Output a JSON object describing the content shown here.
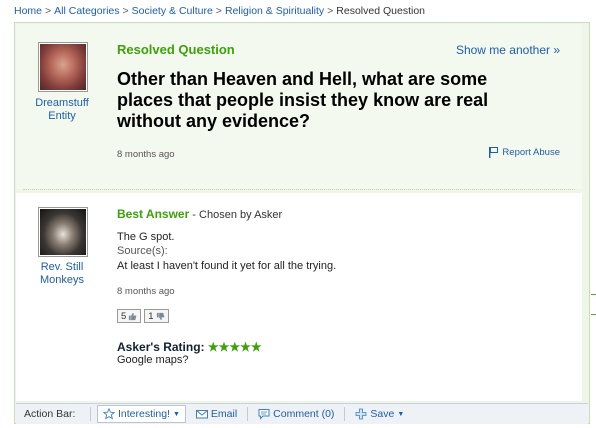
{
  "breadcrumb": [
    {
      "label": "Home",
      "link": true
    },
    {
      "label": "All Categories",
      "link": true
    },
    {
      "label": "Society & Culture",
      "link": true
    },
    {
      "label": "Religion & Spirituality",
      "link": true
    },
    {
      "label": "Resolved Question",
      "link": false
    }
  ],
  "breadcrumb_separator": ">",
  "question": {
    "status": "Resolved Question",
    "show_another": "Show me another »",
    "asker_name_line1": "Dreamstuff",
    "asker_name_line2": "Entity",
    "title": "Other than Heaven and Hell, what are some places that people insist they know are real without any evidence?",
    "time_ago": "8 months ago",
    "report_abuse": "Report Abuse"
  },
  "answer": {
    "best_answer_label": "Best Answer",
    "chosen_by": " - Chosen by Asker",
    "answerer_line1": "Rev. Still",
    "answerer_line2": "Monkeys",
    "text": "The G spot.",
    "sources_label": "Source(s):",
    "source_text": "At least I haven't found it yet for all the trying.",
    "time_ago": "8 months ago",
    "thumbs_up_count": "5",
    "thumbs_down_count": "1",
    "rating_label": "Asker's Rating:",
    "rating_stars": "★★★★★",
    "rating_value": 5,
    "rating_comment": "Google maps?"
  },
  "action_bar": {
    "label": "Action Bar:",
    "interesting": "Interesting!",
    "email": "Email",
    "comment": "Comment (0)",
    "save": "Save"
  },
  "colors": {
    "accent_green": "#3ea10b",
    "link_blue": "#1f5da8",
    "panel_bg": "#eef6e8"
  }
}
